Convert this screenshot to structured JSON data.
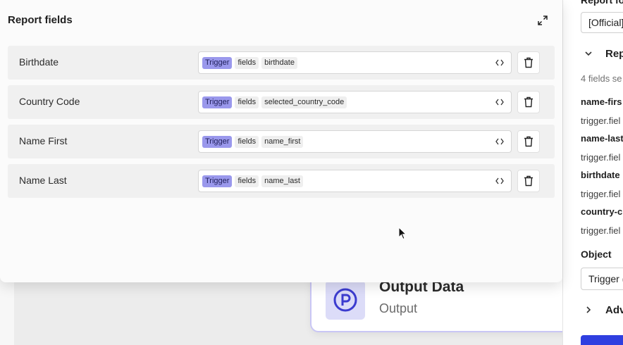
{
  "modal": {
    "title": "Report fields",
    "rows": [
      {
        "label": "Birthdate",
        "tokens": [
          "Trigger",
          "fields",
          "birthdate"
        ]
      },
      {
        "label": "Country Code",
        "tokens": [
          "Trigger",
          "fields",
          "selected_country_code"
        ]
      },
      {
        "label": "Name First",
        "tokens": [
          "Trigger",
          "fields",
          "name_first"
        ]
      },
      {
        "label": "Name Last",
        "tokens": [
          "Trigger",
          "fields",
          "name_last"
        ]
      }
    ],
    "icons": {
      "expand": "expand-icon",
      "code": "code-icon",
      "delete": "trash-icon"
    }
  },
  "canvas": {
    "node": {
      "title": "Output Data",
      "subtitle": "Output",
      "icon": "p-circle-icon"
    }
  },
  "side_panel": {
    "top_label": "Report fo",
    "report_select": "[Official]",
    "section_title": "Rep",
    "fields_note": "4 fields se",
    "fields": [
      {
        "key": "name-firs",
        "value": "trigger.fiel"
      },
      {
        "key": "name-last",
        "value": "trigger.fiel"
      },
      {
        "key": "birthdate",
        "value": "trigger.fiel"
      },
      {
        "key": "country-c",
        "value": "trigger.fiel"
      }
    ],
    "object_label": "Object",
    "object_select": "Trigger (",
    "advanced_title": "Adv"
  },
  "colors": {
    "trigger_token": "#9a98ec",
    "node_border": "#c9c6f5",
    "node_icon_bg": "#dcdcf8",
    "primary_button": "#2f3fe0"
  }
}
